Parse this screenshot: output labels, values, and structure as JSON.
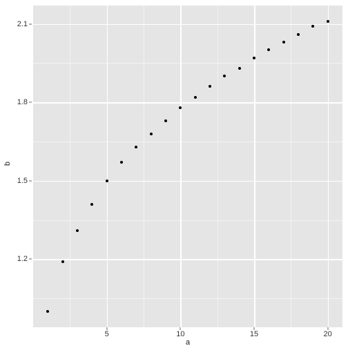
{
  "chart_data": {
    "type": "scatter",
    "x": [
      1,
      2,
      3,
      4,
      5,
      6,
      7,
      8,
      9,
      10,
      11,
      12,
      13,
      14,
      15,
      16,
      17,
      18,
      19,
      20
    ],
    "y": [
      1.0,
      1.19,
      1.31,
      1.41,
      1.5,
      1.57,
      1.63,
      1.68,
      1.73,
      1.78,
      1.82,
      1.86,
      1.9,
      1.93,
      1.97,
      2.0,
      2.03,
      2.06,
      2.09,
      2.11
    ],
    "xlabel": "a",
    "ylabel": "b",
    "xlim": [
      0,
      21
    ],
    "ylim": [
      0.94,
      2.17
    ],
    "xticks": [
      5,
      10,
      15,
      20
    ],
    "yticks": [
      1.2,
      1.5,
      1.8,
      2.1
    ],
    "xminor": [
      2.5,
      7.5,
      12.5,
      17.5
    ],
    "yminor": [
      1.05,
      1.35,
      1.65,
      1.95
    ],
    "grid": true,
    "title": ""
  }
}
